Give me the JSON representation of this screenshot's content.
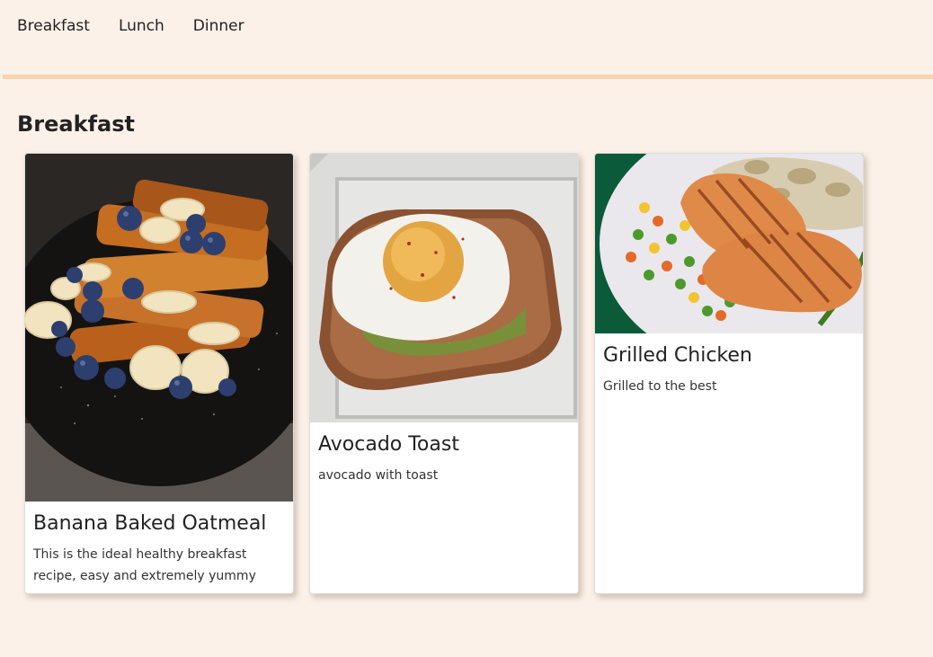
{
  "nav": {
    "items": [
      {
        "label": "Breakfast"
      },
      {
        "label": "Lunch"
      },
      {
        "label": "Dinner"
      }
    ]
  },
  "section": {
    "title": "Breakfast"
  },
  "cards": [
    {
      "title": "Banana Baked Oatmeal",
      "description": "This is the ideal healthy breakfast recipe, easy and extremely yummy",
      "image": "french-toast-photo"
    },
    {
      "title": "Avocado Toast",
      "description": "avocado with toast",
      "image": "egg-toast-photo"
    },
    {
      "title": "Grilled Chicken",
      "description": "Grilled to the best",
      "image": "grilled-chicken-photo"
    }
  ],
  "colors": {
    "page_background": "#fcf1e8",
    "divider": "#f8d3b0",
    "card_background": "#ffffff"
  }
}
